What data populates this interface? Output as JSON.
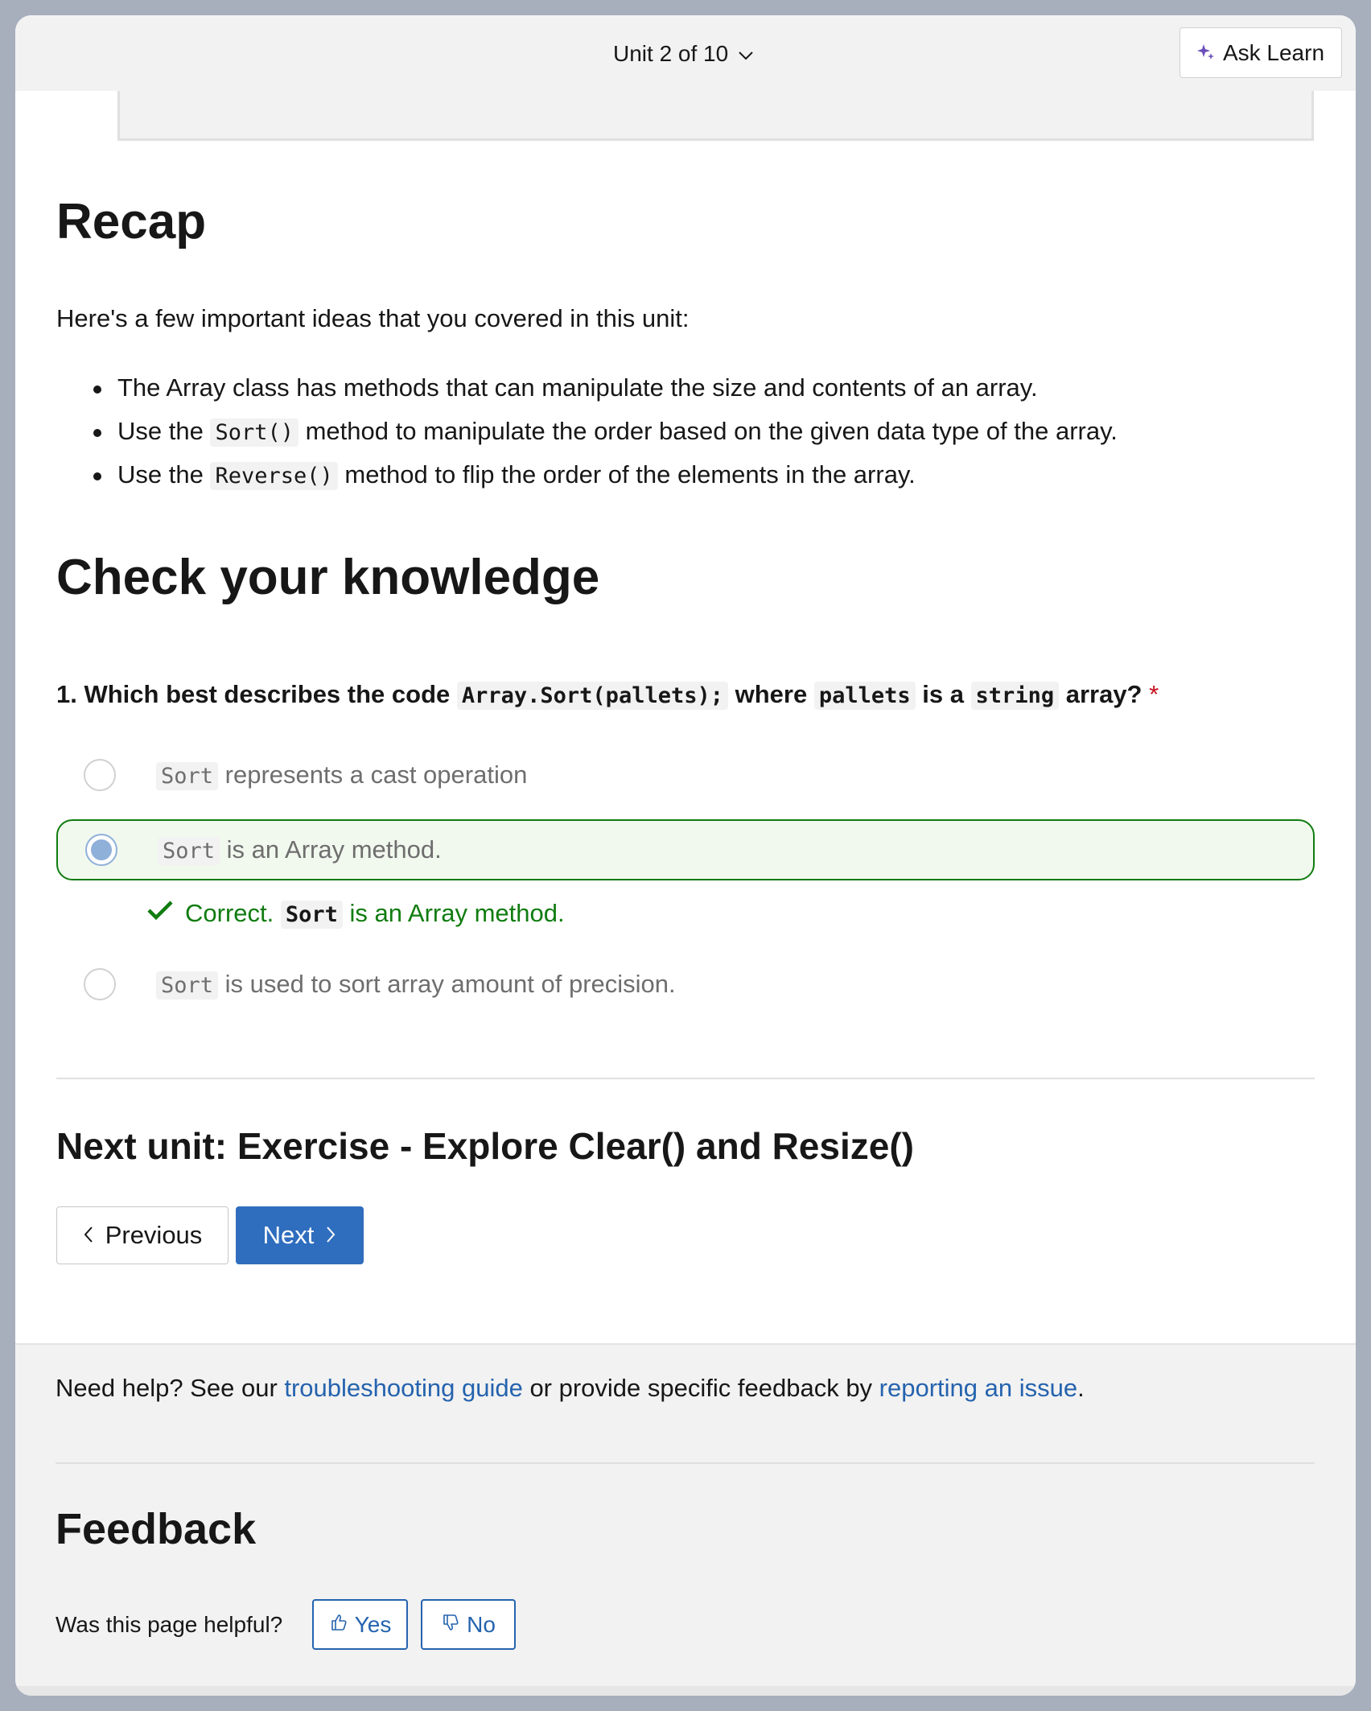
{
  "header": {
    "unit_selector": "Unit 2 of 10",
    "ask_learn": "Ask Learn"
  },
  "recap": {
    "title": "Recap",
    "intro": "Here's a few important ideas that you covered in this unit:",
    "points": [
      {
        "before": "The Array class has methods that can manipulate the size and contents of an array.",
        "code": "",
        "after": ""
      },
      {
        "before": "Use the ",
        "code": "Sort()",
        "after": " method to manipulate the order based on the given data type of the array."
      },
      {
        "before": "Use the ",
        "code": "Reverse()",
        "after": " method to flip the order of the elements in the array."
      }
    ]
  },
  "knowledge": {
    "title": "Check your knowledge",
    "question": {
      "number_text": "1. Which best describes the code ",
      "code1": "Array.Sort(pallets);",
      "mid1": " where ",
      "code2": "pallets",
      "mid2": " is a ",
      "code3": "string",
      "end": " array?",
      "required_mark": "*"
    },
    "options": [
      {
        "code": "Sort",
        "text": " represents a cast operation",
        "selected": false
      },
      {
        "code": "Sort",
        "text": " is an Array method.",
        "selected": true
      },
      {
        "code": "Sort",
        "text": " is used to sort array amount of precision.",
        "selected": false
      }
    ],
    "feedback": {
      "prefix": "Correct. ",
      "code": "Sort",
      "suffix": " is an Array method."
    }
  },
  "navigation": {
    "next_unit": "Next unit: Exercise - Explore Clear() and Resize()",
    "previous_label": "Previous",
    "next_label": "Next"
  },
  "footer": {
    "help_prefix": "Need help? See our ",
    "help_link1": "troubleshooting guide",
    "help_mid": " or provide specific feedback by ",
    "help_link2": "reporting an issue",
    "help_suffix": ".",
    "feedback_title": "Feedback",
    "helpful_question": "Was this page helpful?",
    "yes_label": "Yes",
    "no_label": "No"
  },
  "colors": {
    "accent": "#2f6dbe",
    "link": "#2563ae",
    "correct": "#107c10",
    "required": "#c50f1f"
  }
}
